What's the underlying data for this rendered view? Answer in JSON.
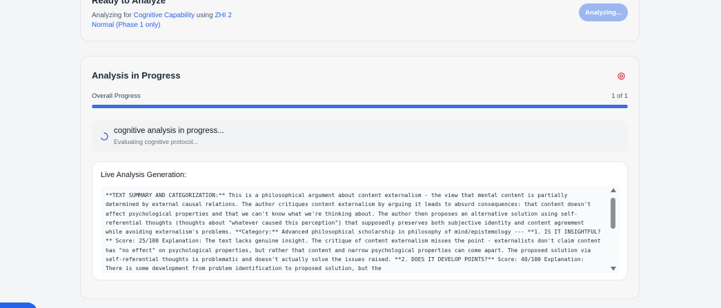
{
  "ready": {
    "title": "Ready to Analyze",
    "prefix": "Analyzing for ",
    "capability": "Cognitive Capability",
    "using": " using ",
    "model": "ZHI 2",
    "mode": "Normal (Phase 1 only)",
    "button_label": "Analyzing..."
  },
  "progress": {
    "title": "Analysis in Progress",
    "overall_label": "Overall Progress",
    "overall_count": "1 of 1",
    "fraction_complete": 1.0
  },
  "status": {
    "title": "cognitive analysis in progress...",
    "subtitle": "Evaluating cognitive protocol..."
  },
  "live": {
    "label": "Live Analysis Generation:",
    "text": "**TEXT SUMMARY AND CATEGORIZATION:** This is a philosophical argument about content externalism - the view that mental content is partially determined by external causal relations. The author critiques content externalism by arguing it leads to absurd consequences: that content doesn't affect psychological properties and that we can't know what we're thinking about. The author then proposes an alternative solution using self-referential thoughts (thoughts about \"whatever caused this perception\") that supposedly preserves both subjective identity and content agreement while avoiding externalism's problems. **Category:** Advanced philosophical scholarship in philosophy of mind/epistemology --- **1. IS IT INSIGHTFUL?** Score: 25/100 Explanation: The text lacks genuine insight. The critique of content externalism misses the point - externalists don't claim content has \"no effect\" on psychological properties, but rather that content and narrow psychological properties can come apart. The proposed solution via self-referential thoughts is problematic and doesn't actually solve the issues raised. **2. DOES IT DEVELOP POINTS?** Score: 40/100 Explanation: There is some development from problem identification to proposed solution, but the"
  },
  "colors": {
    "accent": "#2563eb",
    "progress_fill": "#3b6fe0",
    "cancel": "#dc2626",
    "button_disabled": "#9db8f1"
  },
  "icons": {
    "cancel": "x-circle-icon",
    "spinner": "loading-spinner-icon"
  }
}
